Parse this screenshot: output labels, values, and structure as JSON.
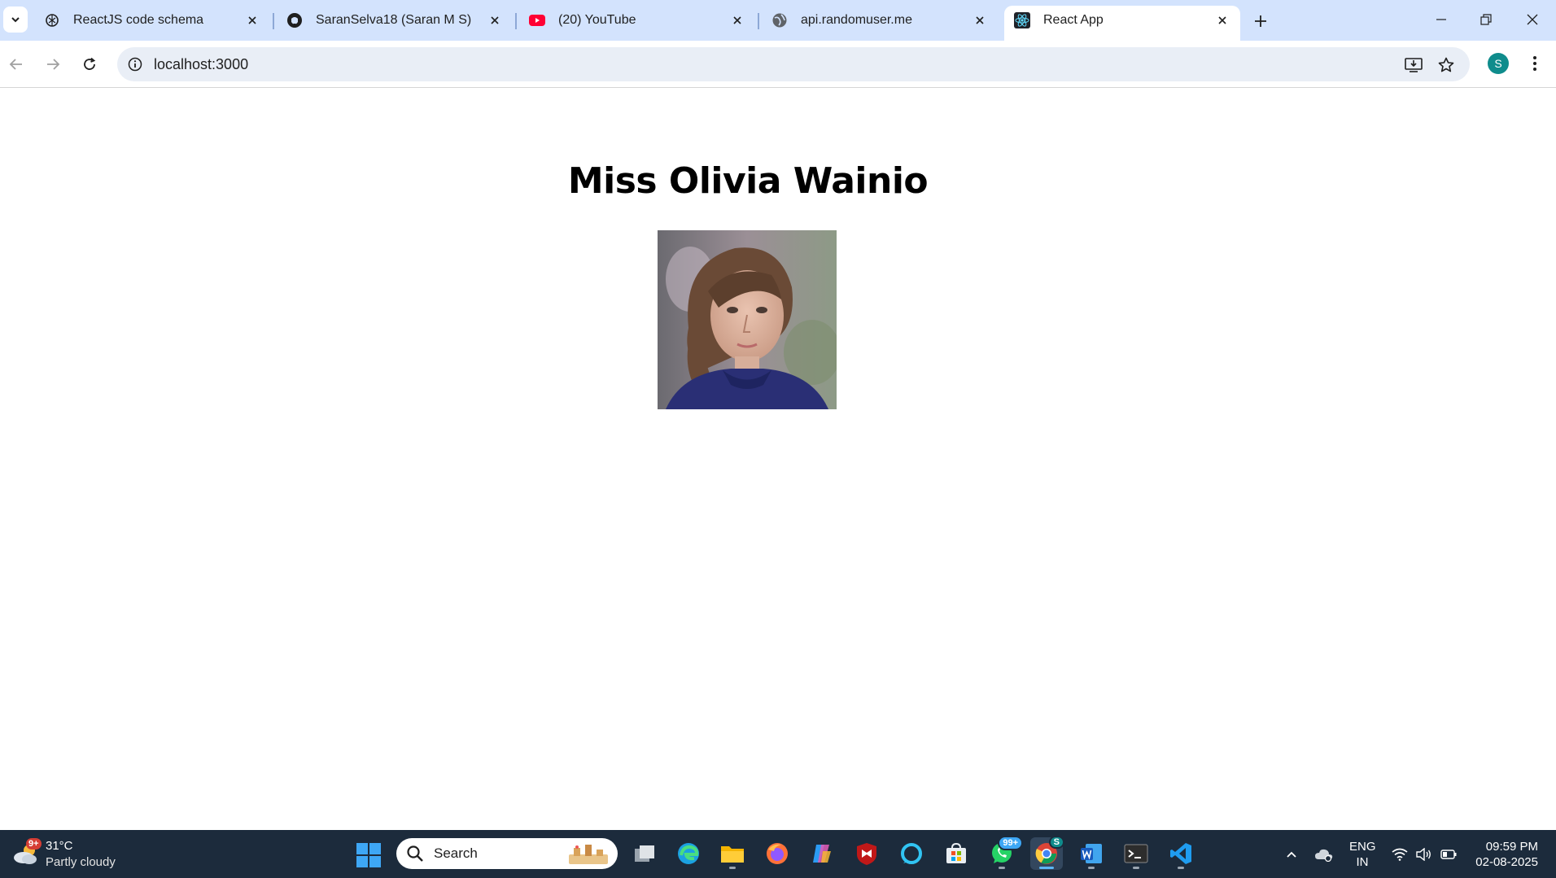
{
  "browser": {
    "tabs": [
      {
        "title": "ReactJS code schema",
        "icon": "chatgpt-icon",
        "active": false
      },
      {
        "title": "SaranSelva18 (Saran M S)",
        "icon": "github-icon",
        "active": false
      },
      {
        "title": "(20) YouTube",
        "icon": "youtube-icon",
        "active": false
      },
      {
        "title": "api.randomuser.me",
        "icon": "globe-icon",
        "active": false
      },
      {
        "title": "React App",
        "icon": "react-icon",
        "active": true
      }
    ],
    "url": "localhost:3000",
    "profile_initial": "S"
  },
  "page": {
    "user_name": "Miss Olivia Wainio"
  },
  "taskbar": {
    "weather": {
      "temp": "31°C",
      "desc": "Partly cloudy",
      "badge": "9+"
    },
    "search_label": "Search",
    "whatsapp_badge": "99+",
    "chrome_badge": "S",
    "language": {
      "line1": "ENG",
      "line2": "IN"
    },
    "clock": {
      "time": "09:59 PM",
      "date": "02-08-2025"
    }
  },
  "colors": {
    "tabstrip": "#d3e3fd",
    "taskbar": "#1c2b3c",
    "accent": "#3ea7f5",
    "avatar": "#0f8c8c"
  }
}
